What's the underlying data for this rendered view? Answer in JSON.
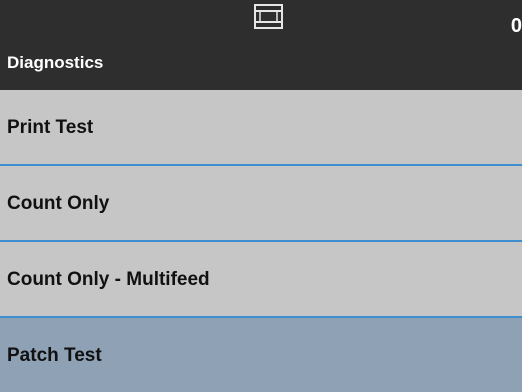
{
  "header": {
    "title": "Diagnostics",
    "count": "0",
    "icon": "scanner-tray-icon"
  },
  "menu": {
    "items": [
      {
        "label": "Print Test",
        "selected": false
      },
      {
        "label": "Count Only",
        "selected": false
      },
      {
        "label": "Count Only - Multifeed",
        "selected": false
      },
      {
        "label": "Patch Test",
        "selected": true
      }
    ]
  },
  "colors": {
    "header_bg": "#2e2e2e",
    "item_bg": "#c6c6c6",
    "selected_bg": "#8fa1b5",
    "divider": "#3f8ed0",
    "header_text": "#ffffff",
    "item_text": "#111111"
  }
}
